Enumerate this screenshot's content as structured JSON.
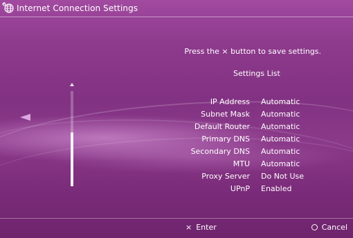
{
  "header": {
    "title": "Internet Connection Settings",
    "icon": "globe-network-icon"
  },
  "instruction": "Press the × button to save settings.",
  "list_title": "Settings List",
  "settings": [
    {
      "label": "IP Address",
      "value": "Automatic"
    },
    {
      "label": "Subnet Mask",
      "value": "Automatic"
    },
    {
      "label": "Default Router",
      "value": "Automatic"
    },
    {
      "label": "Primary DNS",
      "value": "Automatic"
    },
    {
      "label": "Secondary DNS",
      "value": "Automatic"
    },
    {
      "label": "MTU",
      "value": "Automatic"
    },
    {
      "label": "Proxy Server",
      "value": "Do Not Use"
    },
    {
      "label": "UPnP",
      "value": "Enabled"
    }
  ],
  "footer": {
    "enter_glyph": "×",
    "enter_label": "Enter",
    "cancel_label": "Cancel"
  },
  "colors": {
    "background": "#8a3689",
    "text": "#ffffff"
  }
}
